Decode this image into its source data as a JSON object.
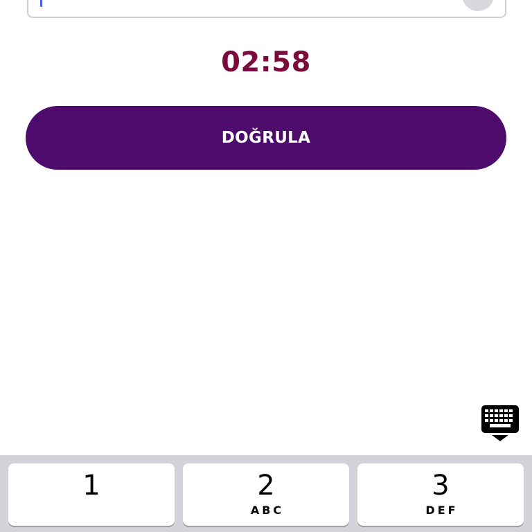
{
  "otp": {
    "value": ""
  },
  "timer": {
    "text": "02:58"
  },
  "verify_button": {
    "label": "DOĞRULA"
  },
  "keyboard_toggle": {
    "icon": "keyboard-dismiss-icon"
  },
  "keypad": {
    "keys": [
      {
        "digit": "1",
        "letters": ""
      },
      {
        "digit": "2",
        "letters": "ABC"
      },
      {
        "digit": "3",
        "letters": "DEF"
      }
    ]
  },
  "colors": {
    "timer": "#7a0b3c",
    "button": "#4d0c6c",
    "caret": "#4a63e6",
    "keyboard_bg": "#d2d3d8"
  }
}
